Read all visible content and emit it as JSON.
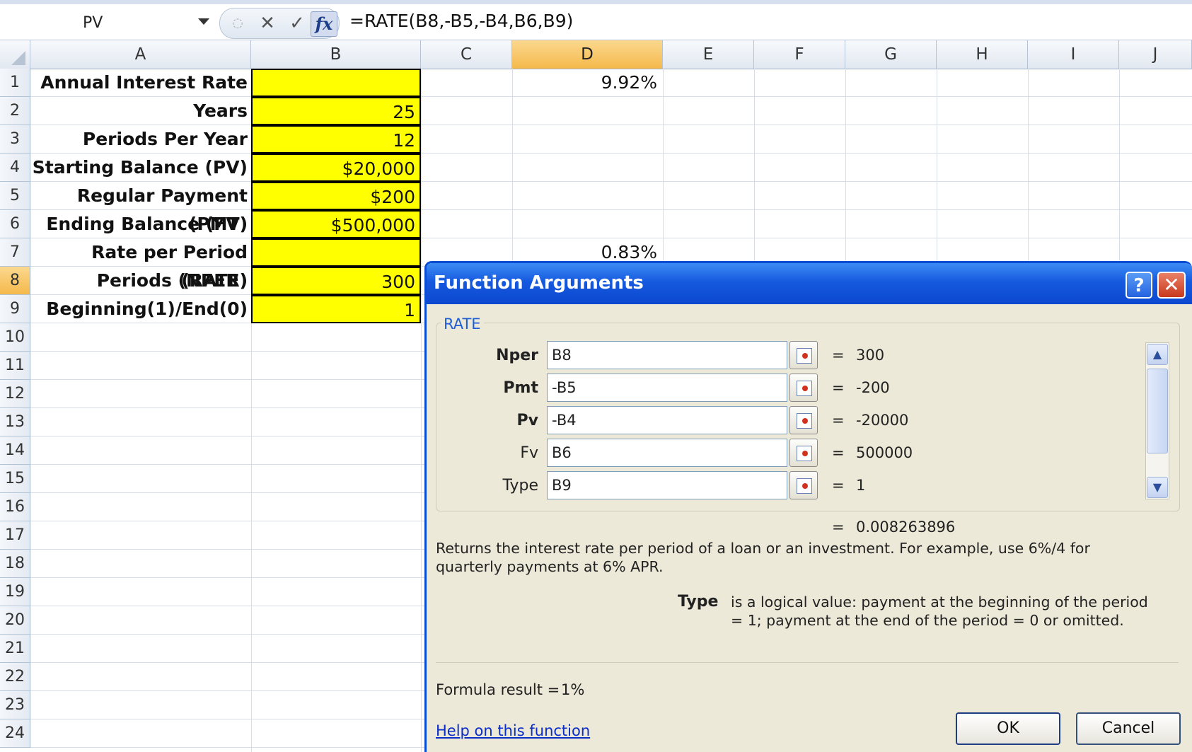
{
  "formula_bar": {
    "name_box": "PV",
    "cancel_glyph": "✕",
    "enter_glyph": "✓",
    "fx_glyph": "fx",
    "formula": "=RATE(B8,-B5,-B4,B6,B9)"
  },
  "columns": [
    "A",
    "B",
    "C",
    "D",
    "E",
    "F",
    "G",
    "H",
    "I",
    "J"
  ],
  "selected_column": "D",
  "rows": [
    "1",
    "2",
    "3",
    "4",
    "5",
    "6",
    "7",
    "8",
    "9",
    "10",
    "11",
    "12",
    "13",
    "14",
    "15",
    "16",
    "17",
    "18",
    "19",
    "20",
    "21",
    "22",
    "23",
    "24"
  ],
  "selected_row": "8",
  "labels": [
    "Annual Interest Rate",
    "Years",
    "Periods Per Year",
    "Starting Balance (PV)",
    "Regular Payment (PMT)",
    "Ending Balance (FV)",
    "Rate per Period (RATE)",
    "Periods (NPER)",
    "Beginning(1)/End(0)"
  ],
  "inputs": [
    "",
    "25",
    "12",
    "$20,000",
    "$200",
    "$500,000",
    "",
    "300",
    "1"
  ],
  "d_values": {
    "d1": "9.92%",
    "d7": "0.83%"
  },
  "dialog": {
    "title": "Function Arguments",
    "help_glyph": "?",
    "close_glyph": "✕",
    "function_name": "RATE",
    "args": [
      {
        "label": "Nper",
        "value": "B8",
        "eq": "=",
        "result": "300"
      },
      {
        "label": "Pmt",
        "value": "-B5",
        "eq": "=",
        "result": "-200"
      },
      {
        "label": "Pv",
        "value": "-B4",
        "eq": "=",
        "result": "-20000"
      },
      {
        "label": "Fv",
        "value": "B6",
        "eq": "=",
        "result": "500000"
      },
      {
        "label": "Type",
        "value": "B9",
        "eq": "=",
        "result": "1"
      }
    ],
    "scroll_up_glyph": "▲",
    "scroll_down_glyph": "▼",
    "result_eq": "=",
    "result": "0.008263896",
    "description": "Returns the interest rate per period of a loan or an investment. For example, use 6%/4 for quarterly payments at 6% APR.",
    "arg_name": "Type",
    "arg_description": "is a logical value: payment at the beginning of the period = 1; payment at the end of the period = 0 or omitted.",
    "formula_result_label": "Formula result =",
    "formula_result_value": "1%",
    "help_link": "Help on this function",
    "ok": "OK",
    "cancel": "Cancel"
  },
  "colors": {
    "input_fill": "#ffff00",
    "selected_header": "#f5b94b",
    "title_bar": "#1559df",
    "dialog_bg": "#ece9d8"
  }
}
